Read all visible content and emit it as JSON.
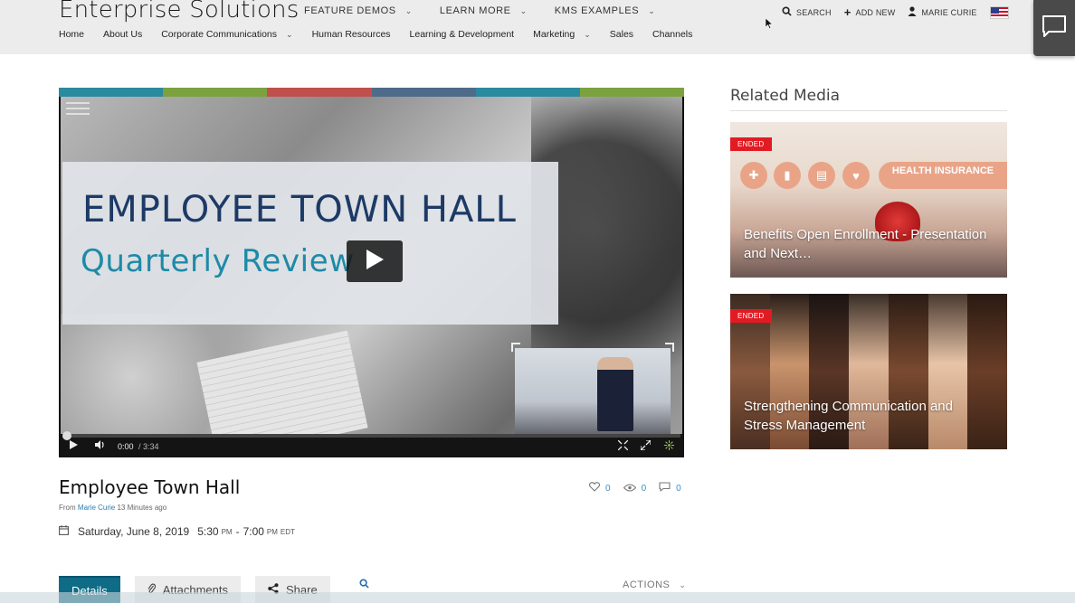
{
  "header": {
    "brand": "Enterprise Solutions",
    "top_nav": [
      {
        "label": "FEATURE DEMOS"
      },
      {
        "label": "LEARN MORE"
      },
      {
        "label": "KMS EXAMPLES"
      }
    ],
    "sub_nav": [
      {
        "label": "Home"
      },
      {
        "label": "About Us"
      },
      {
        "label": "Corporate Communications",
        "dropdown": true
      },
      {
        "label": "Human Resources"
      },
      {
        "label": "Learning & Development"
      },
      {
        "label": "Marketing",
        "dropdown": true
      },
      {
        "label": "Sales"
      },
      {
        "label": "Channels"
      }
    ],
    "utils": {
      "search": "SEARCH",
      "add_new": "ADD NEW",
      "user": "MARIE CURIE"
    }
  },
  "player": {
    "slide_title": "EMPLOYEE TOWN HALL",
    "slide_subtitle": "Quarterly Review",
    "current_time": "0:00",
    "duration": "/ 3:34",
    "progress": 0,
    "color_bar": [
      "#2a8aa0",
      "#7ba23f",
      "#c0504d",
      "#4f6b8a",
      "#2a8aa0",
      "#7ba23f"
    ]
  },
  "media": {
    "title": "Employee Town Hall",
    "from_label": "From",
    "author": "Marie Curie",
    "age": "13 Minutes ago",
    "date": "Saturday, June 8, 2019",
    "start": "5:30",
    "start_period": "PM",
    "end": "7:00",
    "end_period": "PM",
    "tz": "EDT",
    "likes": "0",
    "views": "0",
    "comments": "0"
  },
  "tabs": {
    "details": "Details",
    "attachments": "Attachments",
    "share": "Share",
    "actions": "ACTIONS"
  },
  "related": {
    "title": "Related Media",
    "items": [
      {
        "badge": "ENDED",
        "caption": "Benefits Open Enrollment - Presentation and Next…",
        "image_text": "HEALTH INSURANCE"
      },
      {
        "badge": "ENDED",
        "caption": "Strengthening Communication and Stress Management"
      }
    ]
  },
  "colors": {
    "accent": "#0f6b86",
    "badge": "#e21b23",
    "link": "#2a7db0"
  }
}
